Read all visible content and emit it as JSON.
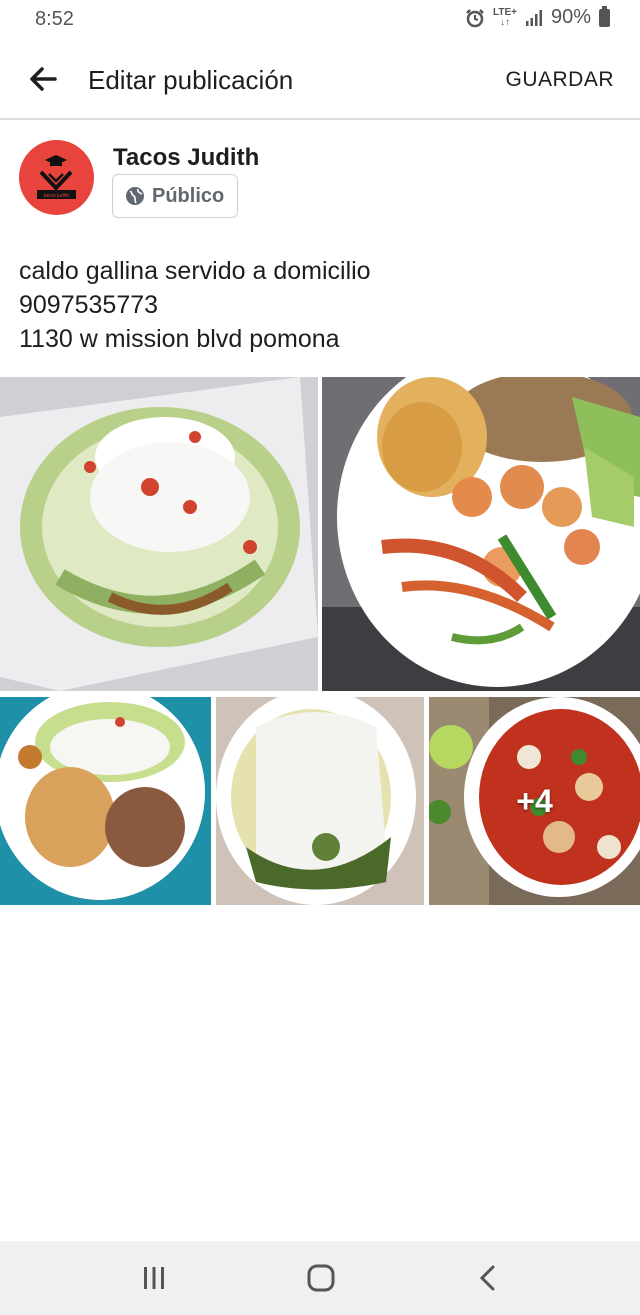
{
  "status_bar": {
    "time": "8:52",
    "network_top": "LTE+",
    "network_bottom": "↓↑",
    "battery": "90%"
  },
  "app_bar": {
    "title": "Editar publicación",
    "save_label": "GUARDAR"
  },
  "post": {
    "author": "Tacos Judith",
    "avatar_text": "tacos judith",
    "privacy_label": "Público",
    "text_lines": [
      "caldo gallina servido a domicilio",
      "9097535773",
      "1130 w mission blvd pomona"
    ]
  },
  "photos": {
    "items": [
      {
        "icon": "tostada-photo"
      },
      {
        "icon": "shrimp-fajita-plate-photo"
      },
      {
        "icon": "enchilada-rice-beans-photo"
      },
      {
        "icon": "green-enchiladas-cream-photo"
      },
      {
        "icon": "chicken-soup-bowl-photo"
      }
    ],
    "more_count": "+4"
  },
  "colors": {
    "accent": "#1c1e21",
    "avatar_bg": "#e8443d",
    "divider": "#dadde1"
  }
}
